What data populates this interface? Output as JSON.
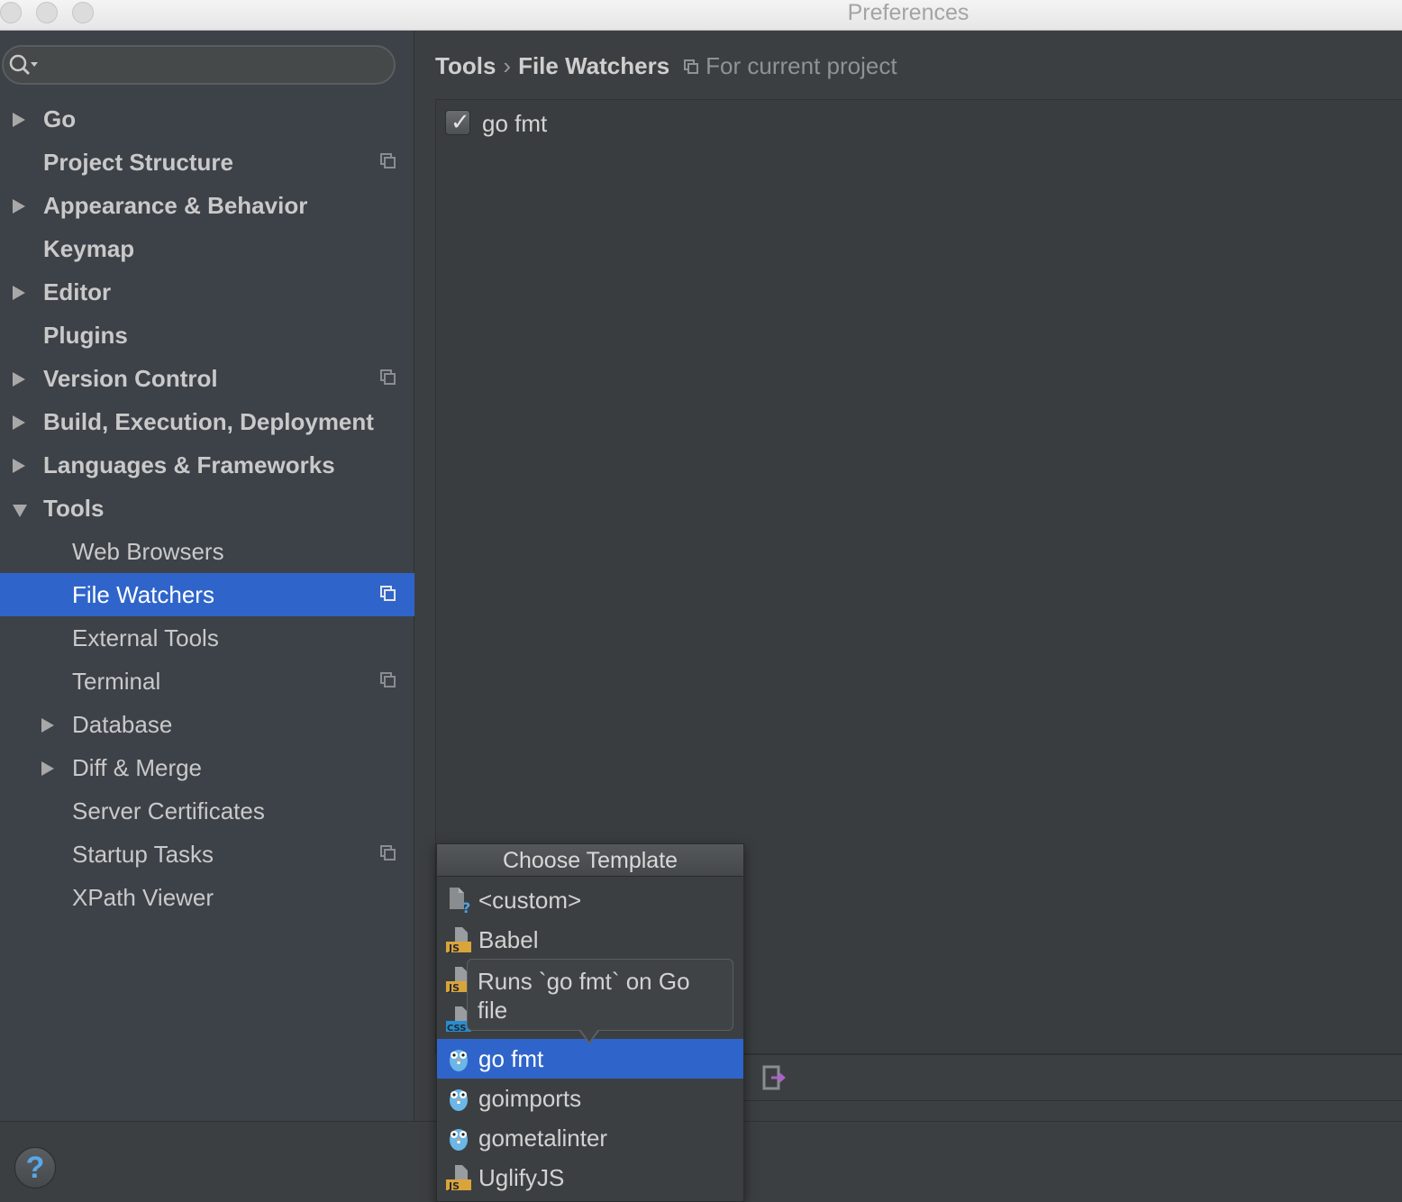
{
  "window": {
    "title": "Preferences"
  },
  "sidebar": {
    "search_placeholder": "",
    "items": [
      {
        "label": "Go",
        "expandable": true,
        "expanded": false,
        "bold": true,
        "project_icon": false
      },
      {
        "label": "Project Structure",
        "expandable": false,
        "bold": true,
        "project_icon": true
      },
      {
        "label": "Appearance & Behavior",
        "expandable": true,
        "expanded": false,
        "bold": true,
        "project_icon": false
      },
      {
        "label": "Keymap",
        "expandable": false,
        "bold": true,
        "project_icon": false
      },
      {
        "label": "Editor",
        "expandable": true,
        "expanded": false,
        "bold": true,
        "project_icon": false
      },
      {
        "label": "Plugins",
        "expandable": false,
        "bold": true,
        "project_icon": false
      },
      {
        "label": "Version Control",
        "expandable": true,
        "expanded": false,
        "bold": true,
        "project_icon": true
      },
      {
        "label": "Build, Execution, Deployment",
        "expandable": true,
        "expanded": false,
        "bold": true,
        "project_icon": false
      },
      {
        "label": "Languages & Frameworks",
        "expandable": true,
        "expanded": false,
        "bold": true,
        "project_icon": false
      },
      {
        "label": "Tools",
        "expandable": true,
        "expanded": true,
        "bold": true,
        "project_icon": false
      },
      {
        "label": "Web Browsers",
        "child": true,
        "project_icon": false
      },
      {
        "label": "File Watchers",
        "child": true,
        "selected": true,
        "project_icon": true
      },
      {
        "label": "External Tools",
        "child": true,
        "project_icon": false
      },
      {
        "label": "Terminal",
        "child": true,
        "project_icon": true
      },
      {
        "label": "Database",
        "child": true,
        "expandable": true,
        "project_icon": false
      },
      {
        "label": "Diff & Merge",
        "child": true,
        "expandable": true,
        "project_icon": false
      },
      {
        "label": "Server Certificates",
        "child": true,
        "project_icon": false
      },
      {
        "label": "Startup Tasks",
        "child": true,
        "project_icon": true
      },
      {
        "label": "XPath Viewer",
        "child": true,
        "project_icon": false
      }
    ]
  },
  "breadcrumb": {
    "parent": "Tools",
    "separator": "›",
    "current": "File Watchers",
    "scope": "For current project"
  },
  "watchers": [
    {
      "label": "go fmt",
      "checked": true
    }
  ],
  "popup": {
    "title": "Choose Template",
    "options": [
      {
        "label": "<custom>",
        "icon": "custom-file-icon"
      },
      {
        "label": "Babel",
        "icon": "js-file-icon"
      },
      {
        "label": "",
        "icon": "js-file-icon"
      },
      {
        "label": "",
        "icon": "css-file-icon"
      },
      {
        "label": "go fmt",
        "icon": "gopher-icon",
        "selected": true
      },
      {
        "label": "goimports",
        "icon": "gopher-icon"
      },
      {
        "label": "gometalinter",
        "icon": "gopher-icon"
      },
      {
        "label": "UglifyJS",
        "icon": "js-file-icon"
      }
    ]
  },
  "tooltip": {
    "line1": "Runs `go fmt` on Go",
    "line2": "file"
  },
  "footer": {
    "help_label": "?"
  },
  "colors": {
    "selection": "#2f65ca",
    "background": "#3c3f41",
    "sidebar": "#3d4148",
    "gopher": "#6ab7e8",
    "js_badge": "#d9a53a",
    "css_badge": "#2a8ccf"
  }
}
